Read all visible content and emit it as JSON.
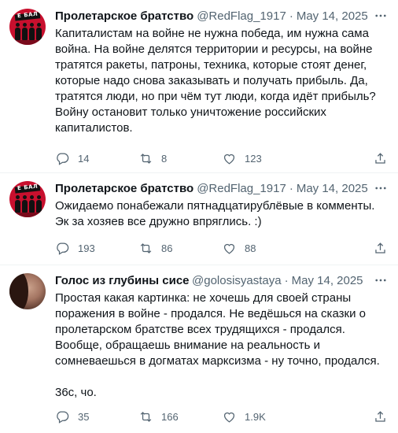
{
  "tweets": [
    {
      "author_name": "Пролетарское братство",
      "handle": "@RedFlag_1917",
      "separator": "·",
      "date": "May 14, 2025",
      "avatar_banner_text": "Е БАЛ",
      "text": "Капиталистам на войне не нужна победа, им нужна сама война. На войне делятся территории и ресурсы, на войне тратятся ракеты, патроны, техника, которые стоят денег, которые надо снова заказывать и получать прибыль. Да, тратятся люди, но при чём тут люди, когда идёт прибыль? Войну остановит только уничтожение российских капиталистов.",
      "replies": "14",
      "retweets": "8",
      "likes": "123"
    },
    {
      "author_name": "Пролетарское братство",
      "handle": "@RedFlag_1917",
      "separator": "·",
      "date": "May 14, 2025",
      "avatar_banner_text": "Е БАЛ",
      "text": "Ожидаемо понабежали пятнадцатирублёвые в комменты.\nЭк за хозяев все дружно впряглись. :)",
      "replies": "193",
      "retweets": "86",
      "likes": "88"
    },
    {
      "author_name": "Голос из глубины сисек",
      "handle": "@golosisyastaya",
      "separator": "·",
      "date": "May 14, 2025",
      "text": "Простая какая картинка: не хочешь для своей страны поражения в войне - продался. Не ведёшься на сказки о пролетарском братстве всех трудящихся - продался. Вообще, обращаешь внимание на реальность и сомневаешься в догматах марксизма - ну точно, продался.\n\n36с, чо.",
      "replies": "35",
      "retweets": "166",
      "likes": "1.9K"
    }
  ],
  "icons": {
    "more": "more-icon",
    "reply": "reply-icon",
    "retweet": "retweet-icon",
    "like": "like-icon",
    "share": "share-icon"
  },
  "colors": {
    "text": "#0f1419",
    "secondary": "#536471",
    "divider": "#eff3f4",
    "avatar_red": "#c8102e"
  }
}
